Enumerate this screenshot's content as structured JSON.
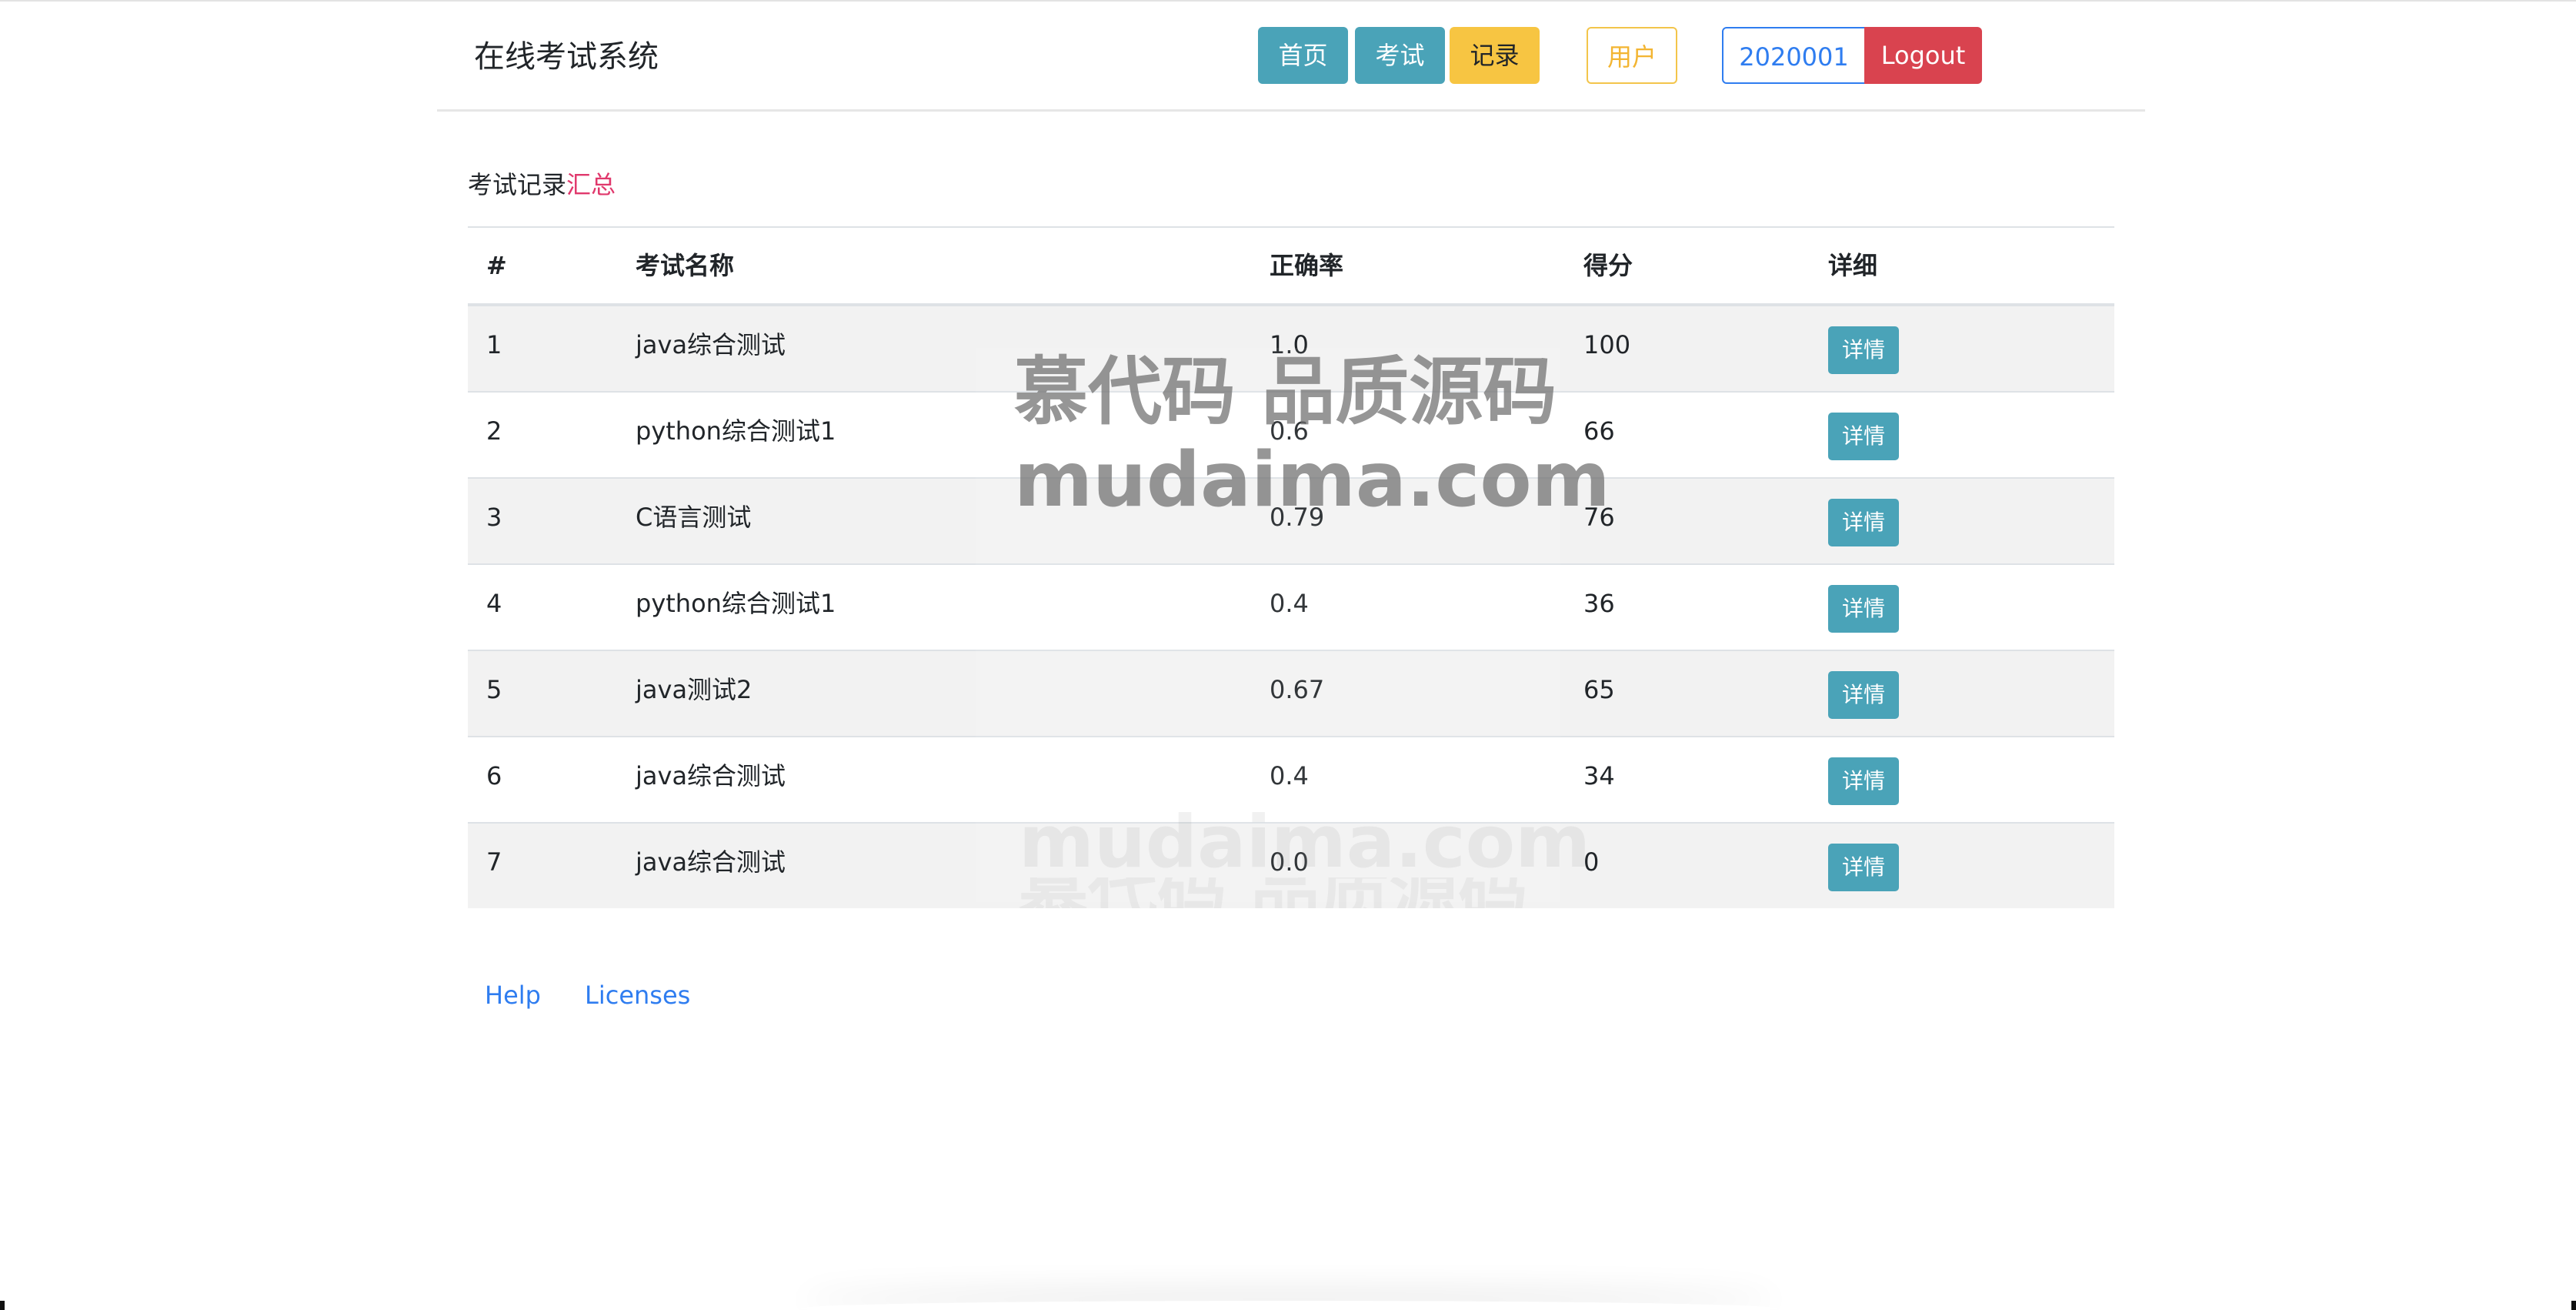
{
  "app": {
    "title": "在线考试系统"
  },
  "nav": {
    "home": "首页",
    "exam": "考试",
    "records": "记录",
    "user": "用户",
    "user_id": "2020001",
    "logout": "Logout"
  },
  "section": {
    "title": "考试记录",
    "summary_link": "汇总"
  },
  "table": {
    "headers": {
      "index": "#",
      "name": "考试名称",
      "accuracy": "正确率",
      "score": "得分",
      "detail": "详细"
    },
    "detail_button_label": "详情",
    "rows": [
      {
        "index": "1",
        "name": "java综合测试",
        "accuracy": "1.0",
        "score": "100"
      },
      {
        "index": "2",
        "name": "python综合测试1",
        "accuracy": "0.6",
        "score": "66"
      },
      {
        "index": "3",
        "name": "C语言测试",
        "accuracy": "0.79",
        "score": "76"
      },
      {
        "index": "4",
        "name": "python综合测试1",
        "accuracy": "0.4",
        "score": "36"
      },
      {
        "index": "5",
        "name": "java测试2",
        "accuracy": "0.67",
        "score": "65"
      },
      {
        "index": "6",
        "name": "java综合测试",
        "accuracy": "0.4",
        "score": "34"
      },
      {
        "index": "7",
        "name": "java综合测试",
        "accuracy": "0.0",
        "score": "0"
      }
    ]
  },
  "footer": {
    "help": "Help",
    "licenses": "Licenses"
  },
  "watermark": {
    "line1": "慕代码 品质源码",
    "line2": "mudaima.com"
  },
  "colors": {
    "info": "#4aa3b8",
    "warning": "#f7c542",
    "danger": "#d9434f",
    "primary": "#2f7df0",
    "summary_link": "#e0386c",
    "stripe": "#f2f2f2"
  }
}
